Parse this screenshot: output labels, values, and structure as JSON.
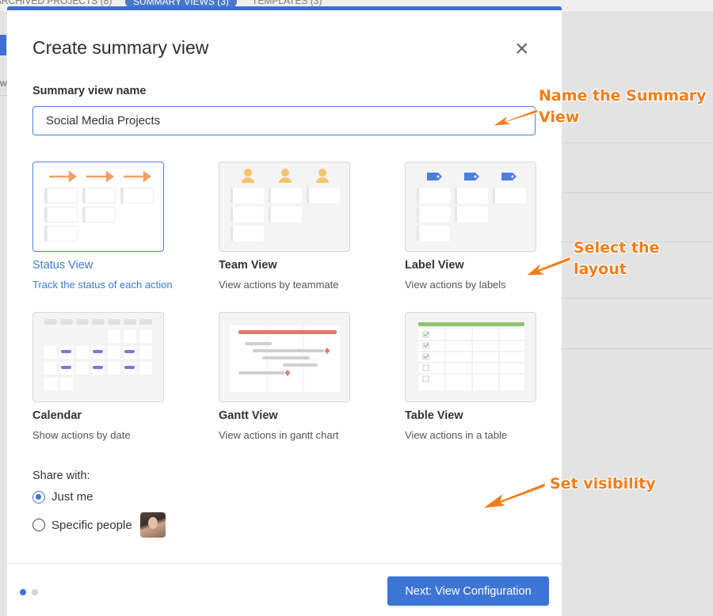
{
  "background": {
    "tabs": [
      "ARCHIVED PROJECTS (8)",
      "SUMMARY VIEWS (3)",
      "TEMPLATES (3)"
    ],
    "left_text": "w"
  },
  "modal": {
    "title": "Create summary view",
    "close_icon": "close-icon",
    "name_label": "Summary view name",
    "name_value": "Social Media Projects",
    "views": [
      {
        "name": "Status View",
        "desc": "Track the status of each action",
        "selected": true
      },
      {
        "name": "Team View",
        "desc": "View actions by teammate",
        "selected": false
      },
      {
        "name": "Label View",
        "desc": "View actions by labels",
        "selected": false
      },
      {
        "name": "Calendar",
        "desc": "Show actions by date",
        "selected": false
      },
      {
        "name": "Gantt View",
        "desc": "View actions in gantt chart",
        "selected": false
      },
      {
        "name": "Table View",
        "desc": "View actions in a table",
        "selected": false
      }
    ],
    "share_label": "Share with:",
    "share_options": [
      {
        "label": "Just me",
        "selected": true
      },
      {
        "label": "Specific people",
        "selected": false
      }
    ],
    "next_button": "Next: View Configuration",
    "pager": {
      "current": 1,
      "total": 2
    }
  },
  "annotations": {
    "name": "Name the Summary\nView",
    "layout": "Select the\nlayout",
    "visibility": "Set visibility"
  },
  "colors": {
    "accent": "#3d74d6",
    "annotation": "#f07d18",
    "arrow_orange": "#f0a065",
    "icon_yellow": "#f5c46c",
    "label_blue": "#4b7fe0",
    "calendar_purple": "#8a6fd6",
    "gantt_red": "#e07a6c",
    "table_green": "#8cc46e"
  }
}
